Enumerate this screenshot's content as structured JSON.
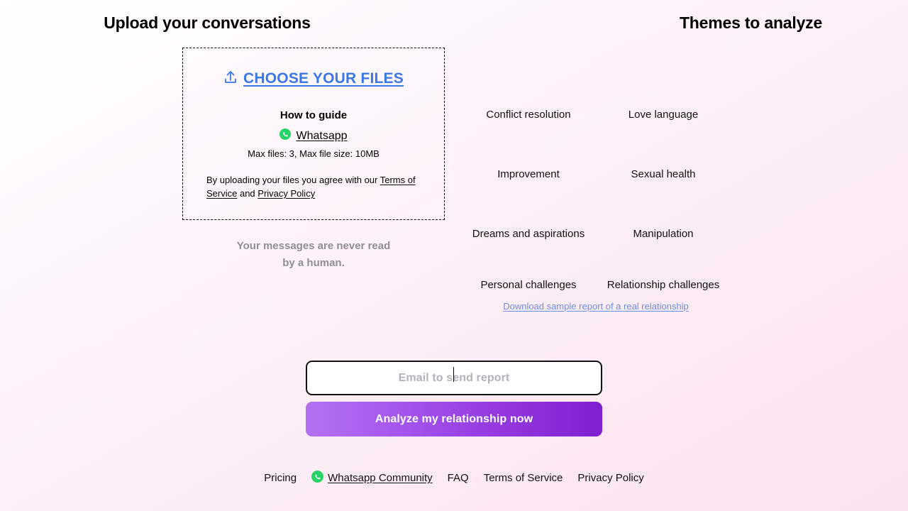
{
  "upload_section": {
    "title": "Upload your conversations",
    "choose_files_label": "CHOOSE YOUR FILES",
    "upload_icon": "upload-arrow-tray-icon",
    "how_to_guide_label": "How to guide",
    "whatsapp_icon": "whatsapp-icon",
    "whatsapp_label": "Whatsapp",
    "file_limits": "Max files: 3, Max file size: 10MB",
    "agree_prefix": "By uploading your files you agree with our ",
    "terms_link": "Terms of Service",
    "agree_middle": " and ",
    "privacy_link": "Privacy Policy",
    "privacy_note_line1": "Your messages are never read",
    "privacy_note_line2": "by a human."
  },
  "themes_section": {
    "title": "Themes to analyze",
    "rows": [
      [
        "Conflict resolution",
        "Love language"
      ],
      [
        "Improvement",
        "Sexual health"
      ],
      [
        "Dreams and aspirations",
        "Manipulation"
      ],
      [
        "Personal challenges",
        "Relationship challenges"
      ]
    ],
    "sample_report_link": "Download sample report of a real relationship"
  },
  "form": {
    "email_value": "",
    "email_placeholder": "Email to send report",
    "submit_label": "Analyze my relationship now"
  },
  "footer": {
    "links": [
      {
        "label": "Pricing",
        "icon": null
      },
      {
        "label": "Whatsapp Community",
        "icon": "whatsapp-icon"
      },
      {
        "label": "FAQ",
        "icon": null
      },
      {
        "label": "Terms of Service",
        "icon": null
      },
      {
        "label": "Privacy Policy",
        "icon": null
      }
    ]
  },
  "colors": {
    "accent_link": "#3b78e7",
    "button_gradient_start": "#b470f2",
    "button_gradient_end": "#7f1fd0",
    "whatsapp_green": "#25d366",
    "muted_text": "#8e8e95",
    "sample_link": "#6b8ee0"
  }
}
